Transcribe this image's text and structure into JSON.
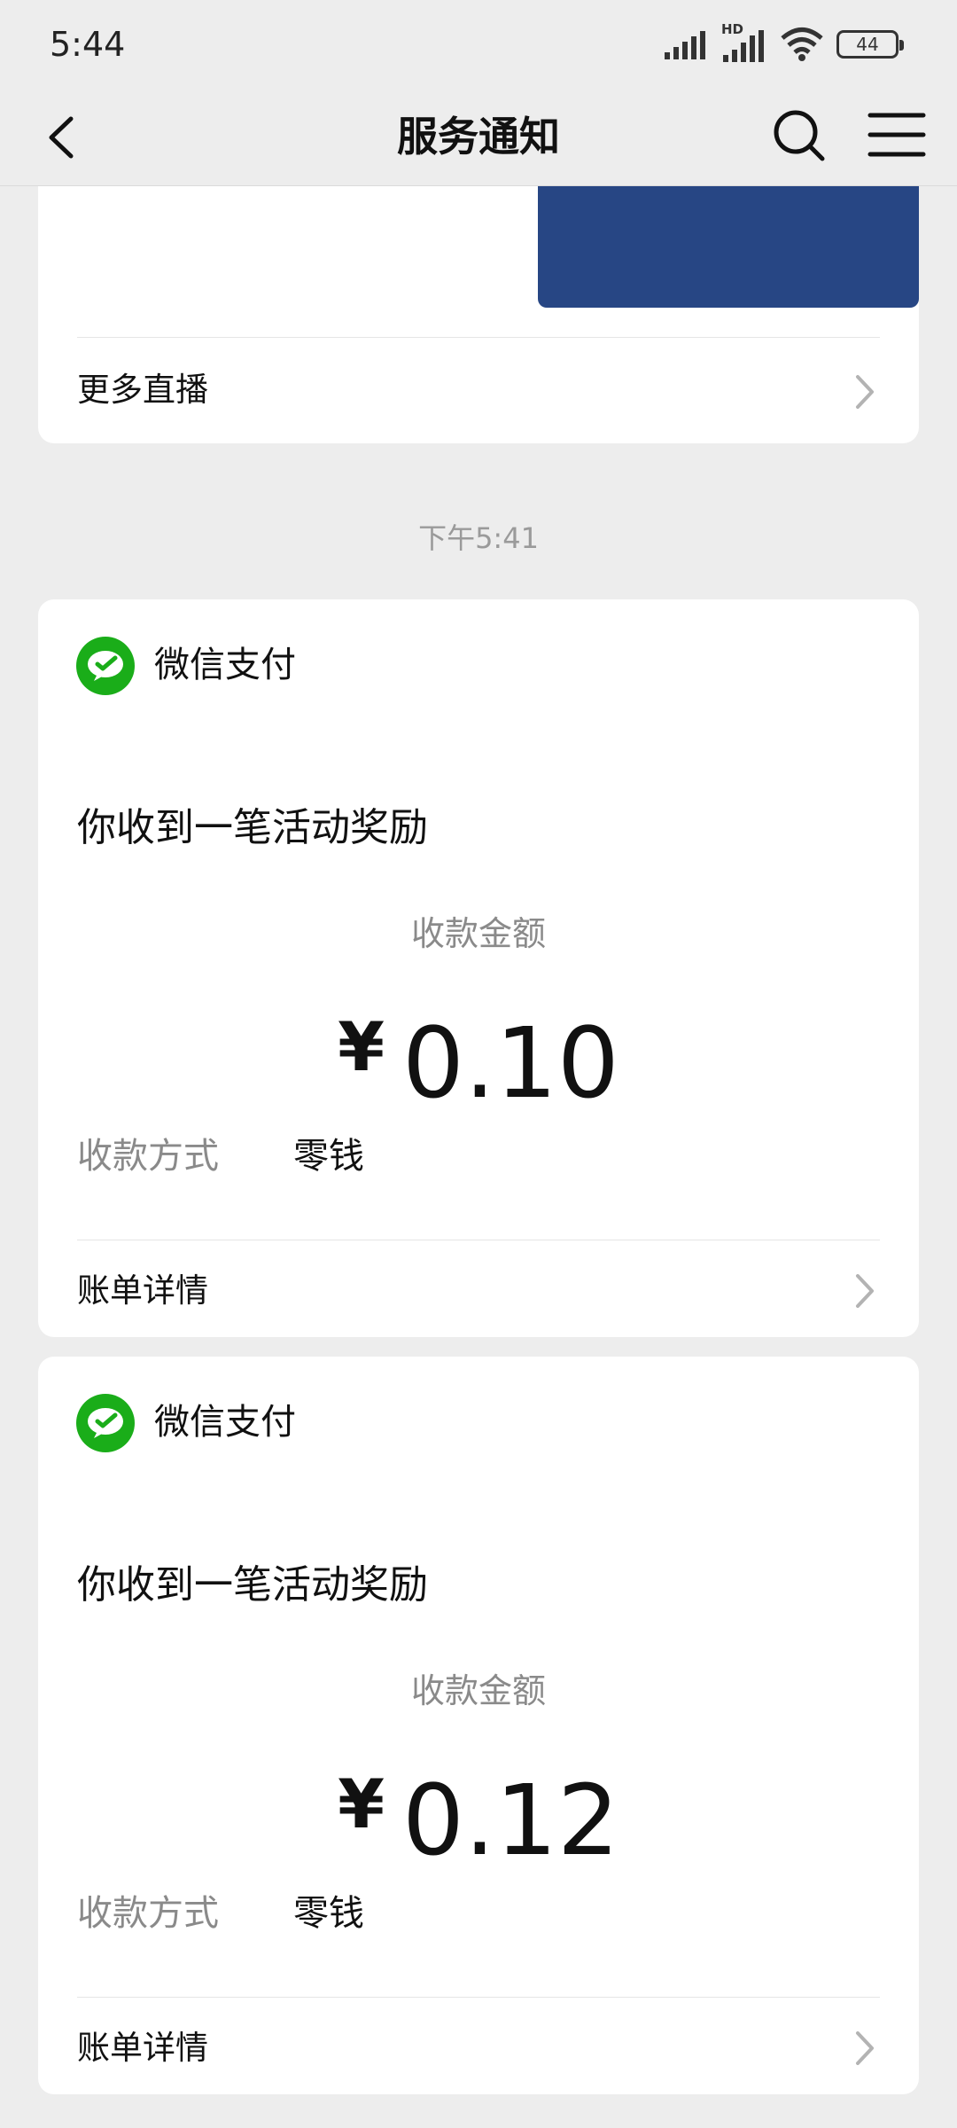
{
  "status_bar": {
    "time": "5:44",
    "network_label": "HD",
    "battery": "44",
    "icons": [
      "signal-icon",
      "hd-signal-icon",
      "wifi-icon",
      "battery-icon"
    ]
  },
  "nav": {
    "title": "服务通知",
    "icons": [
      "back-arrow-icon",
      "search-icon",
      "menu-icon"
    ]
  },
  "top_card": {
    "more_label": "更多直播"
  },
  "timestamp": "下午5:41",
  "payments": [
    {
      "sender": "微信支付",
      "headline": "你收到一笔活动奖励",
      "amount_label": "收款金额",
      "currency": "¥",
      "amount": "0.10",
      "method_label": "收款方式",
      "method_value": "零钱",
      "details_label": "账单详情"
    },
    {
      "sender": "微信支付",
      "headline": "你收到一笔活动奖励",
      "amount_label": "收款金额",
      "currency": "¥",
      "amount": "0.12",
      "method_label": "收款方式",
      "method_value": "零钱",
      "details_label": "账单详情"
    }
  ],
  "colors": {
    "background": "#ededed",
    "wechat_pay_green": "#1aad19",
    "video_thumb": "#274684"
  }
}
